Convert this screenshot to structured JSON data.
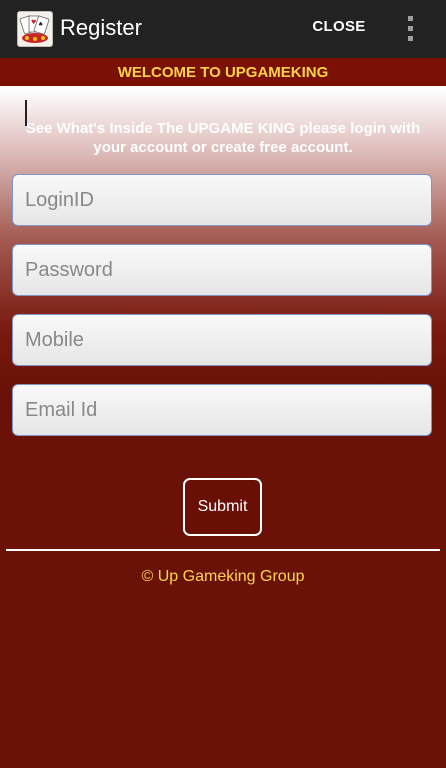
{
  "app": {
    "title": "Register",
    "close_label": "CLOSE",
    "icon": "playing-cards-app-icon",
    "overflow_icon": "overflow-menu-icon"
  },
  "banner": {
    "welcome": "WELCOME TO UPGAMEKING"
  },
  "form": {
    "intro": "See What's Inside The UPGAME KING please login with your account or create free account.",
    "loginid_placeholder": "LoginID",
    "password_placeholder": "Password",
    "mobile_placeholder": "Mobile",
    "email_placeholder": "Email Id",
    "submit_label": "Submit"
  },
  "footer": {
    "text": "© Up Gameking Group"
  },
  "colors": {
    "actionbar": "#222222",
    "background": "#6b1208",
    "accent_text": "#ffd34d",
    "field_border": "#7d95c7"
  }
}
